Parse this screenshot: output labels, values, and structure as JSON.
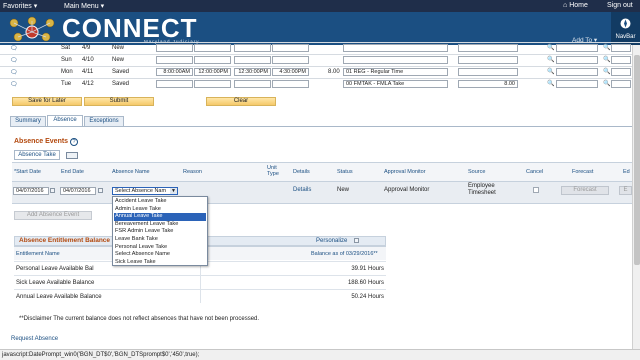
{
  "topbar": {
    "favorites": "Favorites",
    "main_menu": "Main Menu",
    "home": "Home",
    "signout": "Sign out"
  },
  "header": {
    "logo": "CONNECT",
    "logo_sub": "Maryland Judiciary",
    "add_to": "Add To",
    "navbar": "NavBar"
  },
  "timesheet_rows": [
    {
      "day": "Sat",
      "date": "4/9",
      "status": "New"
    },
    {
      "day": "Sun",
      "date": "4/10",
      "status": "New"
    },
    {
      "day": "Mon",
      "date": "4/11",
      "status": "Saved",
      "t1": "8:00:00AM",
      "t2": "12:00:00PM",
      "t3": "12:30:00PM",
      "t4": "4:30:00PM",
      "hours": "8.00",
      "trc": "01 REG - Regular Time"
    },
    {
      "day": "Tue",
      "date": "4/12",
      "status": "Saved",
      "trc": "00 FMTAK - FMLA Take",
      "hours2": "8.00"
    }
  ],
  "buttons": {
    "save_later": "Save for Later",
    "submit": "Submit",
    "clear": "Clear",
    "forecast": "Forecast",
    "add_absence": "Add Absence Event"
  },
  "tabs": [
    "Summary",
    "Absence",
    "Exceptions"
  ],
  "absence_events": {
    "title": "Absence Events",
    "subtab": "Absence Take",
    "headers": {
      "start": "*Start Date",
      "end": "End Date",
      "name": "Absence Name",
      "reason": "Reason",
      "unit": "Unit Type",
      "details": "Details",
      "status": "Status",
      "monitor": "Approval Monitor",
      "source": "Source",
      "cancel": "Cancel",
      "forecast": "Forecast",
      "edit": "Ed"
    },
    "row": {
      "start": "04/07/2016",
      "end": "04/07/2016",
      "name": "Select Absence Nam",
      "details": "Details",
      "status": "New",
      "monitor": "Approval Monitor",
      "source": "Employee Timesheet"
    }
  },
  "dropdown_options": [
    "Accident Leave Take",
    "Admin Leave Take",
    "Annual Leave Take",
    "Bereavement Leave Take",
    "FSR Admin Leave Take",
    "Leave Bank Take",
    "Personal Leave Take",
    "Select Absence Name",
    "Sick Leave Take"
  ],
  "dropdown_selected": "Annual Leave Take",
  "entitlement": {
    "title": "Absence Entitlement Balance",
    "personalize": "Personalize",
    "col_name": "Entitlement Name",
    "col_balance": "Balance as of 03/29/2016**",
    "rows": [
      {
        "name": "Personal Leave Available Bal",
        "value": "39.91 Hours"
      },
      {
        "name": "Sick Leave Available Balance",
        "value": "188.60 Hours"
      },
      {
        "name": "Annual Leave Available Balance",
        "value": "50.24 Hours"
      }
    ]
  },
  "disclaimer": "**Disclaimer  The current balance does not reflect absences that have not been processed.",
  "request_absence": "Request Absence",
  "status_bar": "javascript:DatePrompt_win0('BGN_DT$0','BGN_DTSprompt$0','450',true);",
  "colors": {
    "header": "#1b4f82",
    "topbar": "#1f2e4a",
    "section": "#b3490e",
    "highlight": "#2b63b8"
  }
}
